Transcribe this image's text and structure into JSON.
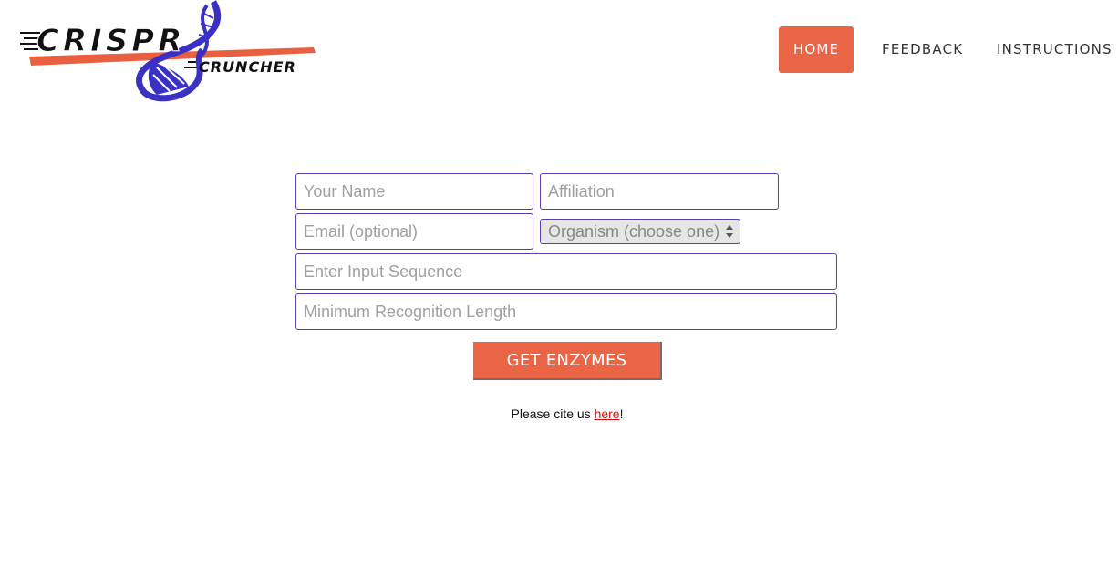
{
  "header": {
    "logo": {
      "name": "CRISPR Cruncher logo",
      "text_top": "CRISPR",
      "text_bottom": "CRUNCHER"
    },
    "nav": [
      {
        "label": "HOME",
        "active": true
      },
      {
        "label": "FEEDBACK",
        "active": false
      },
      {
        "label": "INSTRUCTIONS",
        "active": false
      }
    ]
  },
  "form": {
    "name_placeholder": "Your Name",
    "affiliation_placeholder": "Affiliation",
    "email_placeholder": "Email (optional)",
    "organism_select": {
      "selected": "Organism (choose one)"
    },
    "sequence_placeholder": "Enter Input Sequence",
    "min_length_placeholder": "Minimum Recognition Length",
    "submit_label": "GET ENZYMES"
  },
  "footer": {
    "cite_prefix": "Please cite us ",
    "cite_link": "here",
    "cite_suffix": "!"
  },
  "colors": {
    "accent": "#ea6446",
    "field_border": "#5a3fb3",
    "link": "#cc1111"
  }
}
